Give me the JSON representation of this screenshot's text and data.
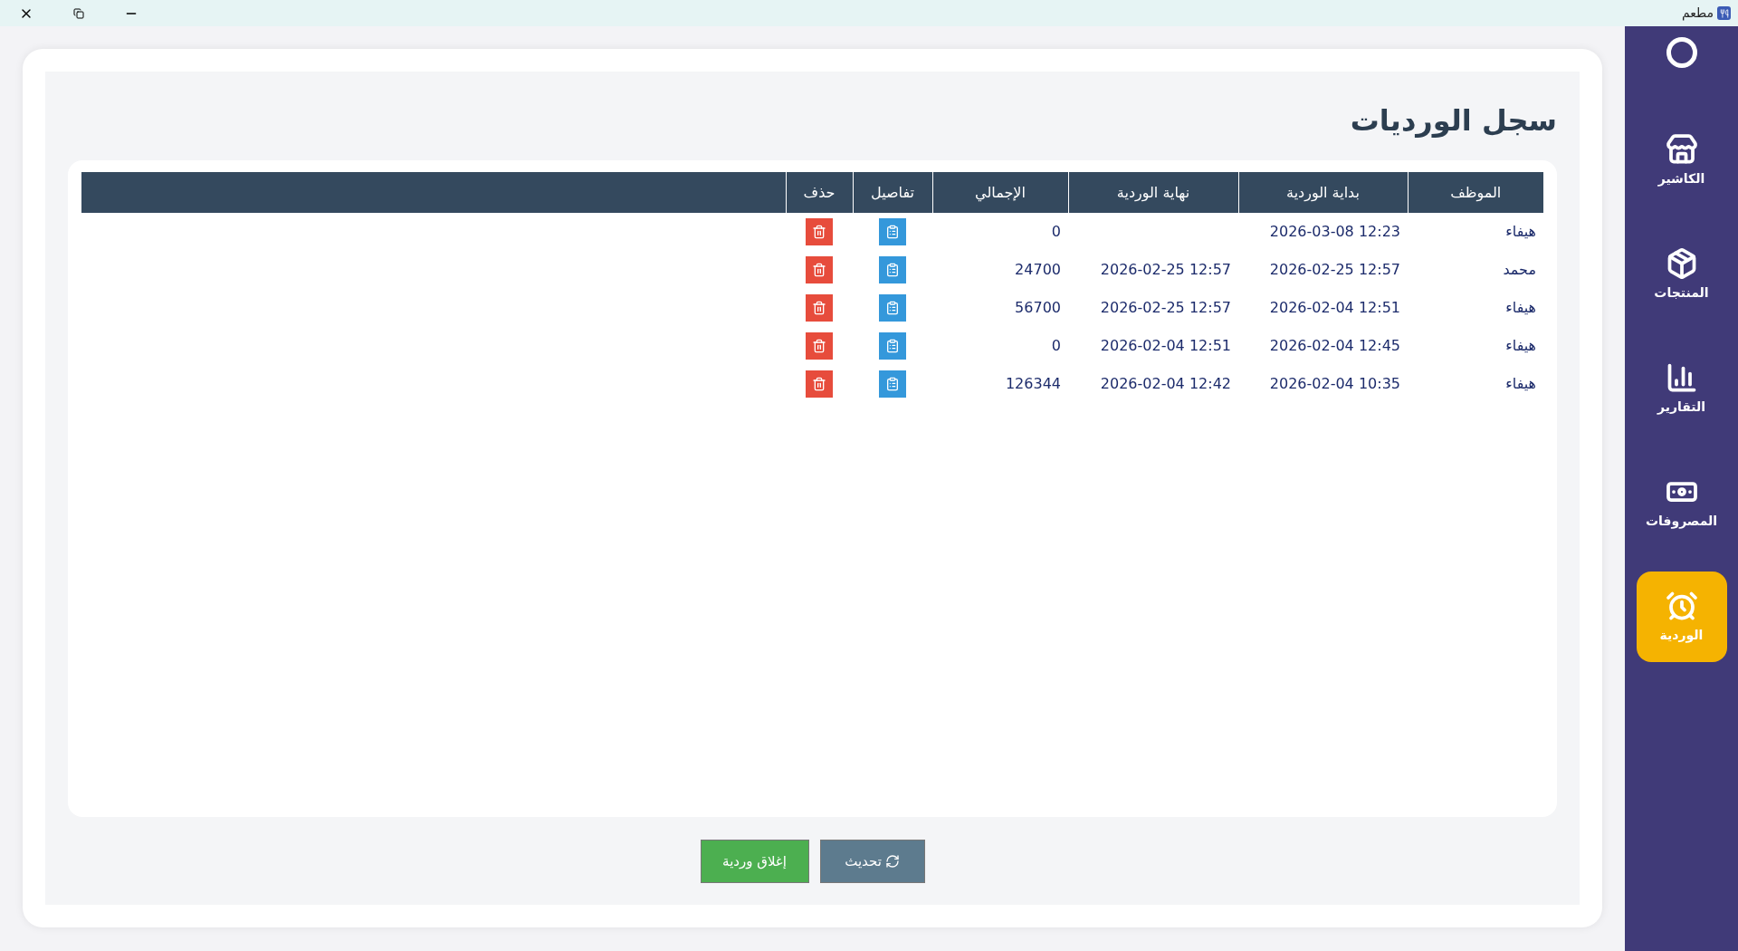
{
  "window": {
    "title": "مطعم"
  },
  "sidebar": {
    "items": [
      {
        "kind": "cashier",
        "label": "الكاشير",
        "selected": false
      },
      {
        "kind": "products",
        "label": "المنتجات",
        "selected": false
      },
      {
        "kind": "reports",
        "label": "التقارير",
        "selected": false
      },
      {
        "kind": "expenses",
        "label": "المصروفات",
        "selected": false
      },
      {
        "kind": "shift",
        "label": "الوردية",
        "selected": true
      }
    ]
  },
  "page": {
    "title": "سجل الورديات"
  },
  "table": {
    "columns": [
      "الموظف",
      "بداية الوردية",
      "نهاية الوردية",
      "الإجمالي",
      "تفاصيل",
      "حذف"
    ],
    "rows": [
      {
        "employee": "هيفاء",
        "start": "2026-03-08 12:23",
        "end": "",
        "total": "0"
      },
      {
        "employee": "محمد",
        "start": "2026-02-25 12:57",
        "end": "2026-02-25 12:57",
        "total": "24700"
      },
      {
        "employee": "هيفاء",
        "start": "2026-02-04 12:51",
        "end": "2026-02-25 12:57",
        "total": "56700"
      },
      {
        "employee": "هيفاء",
        "start": "2026-02-04 12:45",
        "end": "2026-02-04 12:51",
        "total": "0"
      },
      {
        "employee": "هيفاء",
        "start": "2026-02-04 10:35",
        "end": "2026-02-04 12:42",
        "total": "126344"
      }
    ]
  },
  "buttons": {
    "refresh": "تحديث",
    "close_shift": "إغلاق وردية"
  }
}
